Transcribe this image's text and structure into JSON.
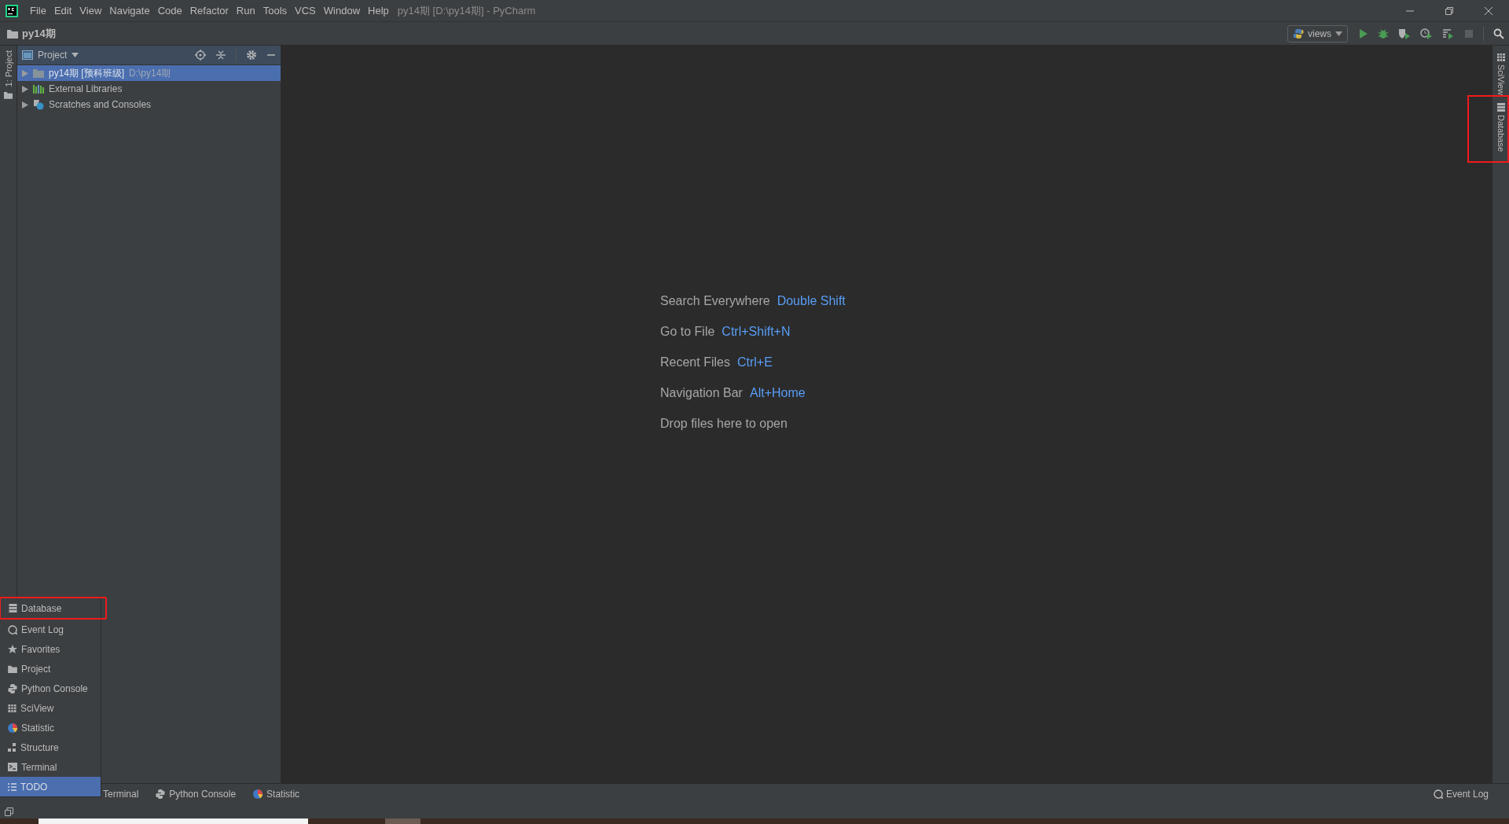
{
  "window": {
    "title": "py14期 [D:\\py14期] - PyCharm"
  },
  "menu": [
    "File",
    "Edit",
    "View",
    "Navigate",
    "Code",
    "Refactor",
    "Run",
    "Tools",
    "VCS",
    "Window",
    "Help"
  ],
  "nav_bar": {
    "path": "py14期"
  },
  "toolbar": {
    "run_config": "views"
  },
  "left_stripe": [
    {
      "label": "1: Project",
      "selected": false
    }
  ],
  "project_panel": {
    "title": "Project",
    "tree": [
      {
        "label": "py14期 [预科班级]",
        "path": "D:\\py14期",
        "kind": "folder",
        "selected": true,
        "expanded": false
      },
      {
        "label": "External Libraries",
        "kind": "libraries",
        "selected": false,
        "expanded": false
      },
      {
        "label": "Scratches and Consoles",
        "kind": "scratches",
        "selected": false,
        "expanded": false
      }
    ]
  },
  "right_stripe": [
    {
      "label": "SciView",
      "kind": "sciview",
      "highlighted": false
    },
    {
      "label": "Database",
      "kind": "database",
      "highlighted": true
    }
  ],
  "editor_hints": [
    {
      "action": "Search Everywhere",
      "shortcut": "Double Shift"
    },
    {
      "action": "Go to File",
      "shortcut": "Ctrl+Shift+N"
    },
    {
      "action": "Recent Files",
      "shortcut": "Ctrl+E"
    },
    {
      "action": "Navigation Bar",
      "shortcut": "Alt+Home"
    },
    {
      "action": "Drop files here to open"
    }
  ],
  "tool_window_popup": [
    {
      "label": "Database",
      "kind": "database",
      "selected": false,
      "highlighted": true
    },
    {
      "label": "Event Log",
      "kind": "eventlog",
      "selected": false,
      "highlighted": false
    },
    {
      "label": "Favorites",
      "kind": "star",
      "selected": false,
      "highlighted": false
    },
    {
      "label": "Project",
      "kind": "folder",
      "selected": false,
      "highlighted": false
    },
    {
      "label": "Python Console",
      "kind": "python",
      "selected": false,
      "highlighted": false
    },
    {
      "label": "SciView",
      "kind": "sciview",
      "selected": false,
      "highlighted": false
    },
    {
      "label": "Statistic",
      "kind": "statistic",
      "selected": false,
      "highlighted": false
    },
    {
      "label": "Structure",
      "kind": "structure",
      "selected": false,
      "highlighted": false
    },
    {
      "label": "Terminal",
      "kind": "terminal",
      "selected": false,
      "highlighted": false
    },
    {
      "label": "TODO",
      "kind": "todo",
      "selected": true,
      "highlighted": false
    }
  ],
  "bottom_tabs": [
    {
      "label": "Terminal"
    },
    {
      "label": "Python Console",
      "kind": "python"
    },
    {
      "label": "Statistic",
      "kind": "statistic"
    }
  ],
  "bottom_right": {
    "label": "Event Log",
    "kind": "eventlog"
  }
}
